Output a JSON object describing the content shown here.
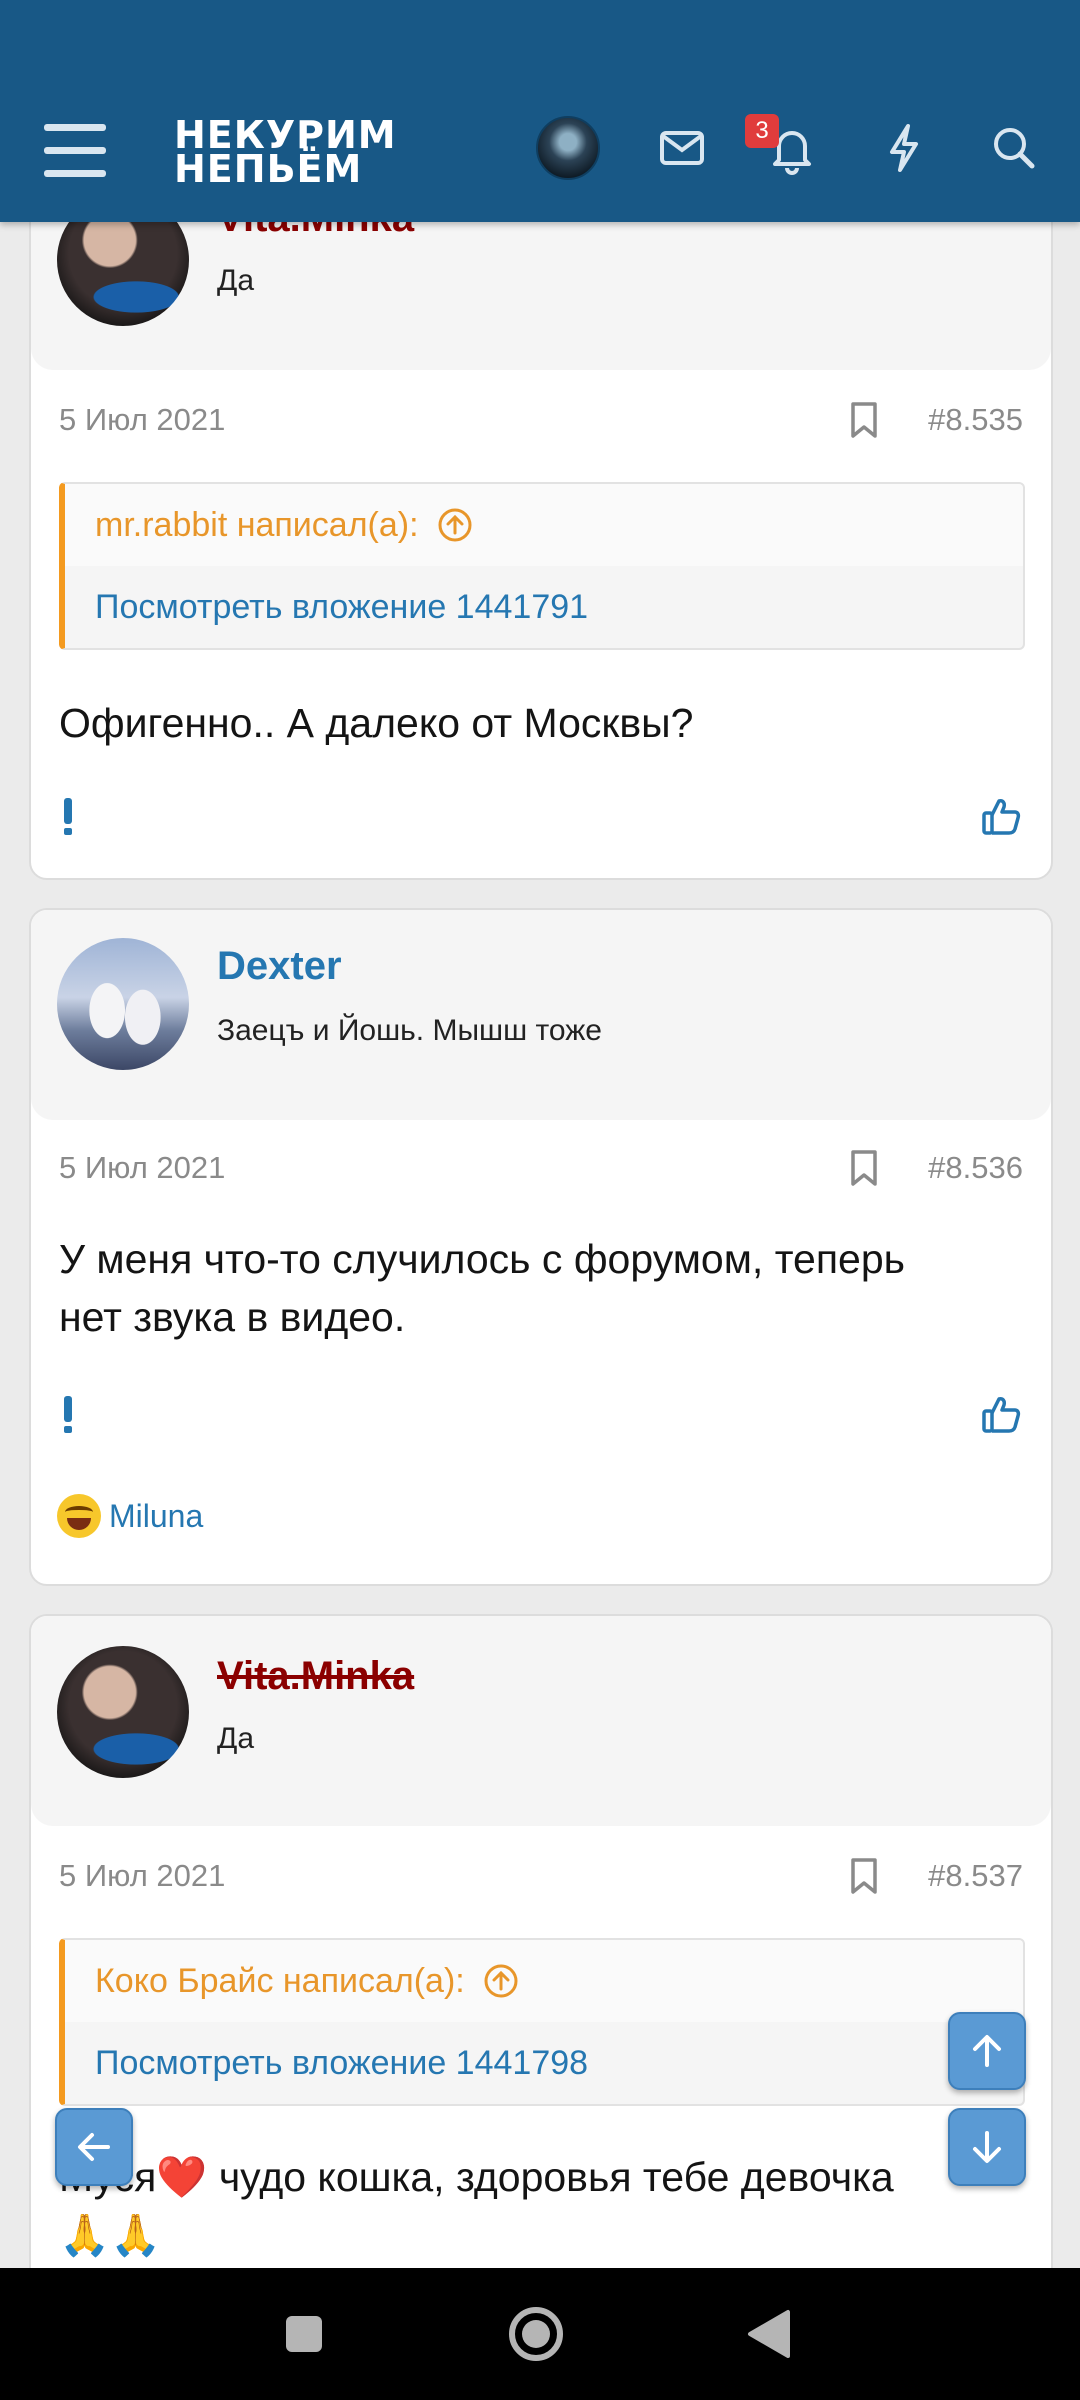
{
  "header": {
    "logo_line1": "НЕКУРИМ",
    "logo_line2": "НЕПЬЁМ",
    "notification_count": "3",
    "icons": [
      "menu-icon",
      "avatar",
      "mail-icon",
      "bell-icon",
      "lightning-icon",
      "search-icon"
    ]
  },
  "posts": [
    {
      "username": "Vita.Minka",
      "user_title": "Да",
      "date": "5 Июл 2021",
      "number": "#8.535",
      "quote_author": "mr.rabbit написал(а):",
      "quote_link": "Посмотреть вложение 1441791",
      "message": "Офигенно.. А далеко от Москвы?"
    },
    {
      "username": "Dexter",
      "user_title": "Заецъ и Йошь. Мышш тоже",
      "date": "5 Июл 2021",
      "number": "#8.536",
      "message_line1": "У меня что-то случилось с форумом, теперь",
      "message_line2": "нет звука в видео.",
      "reaction_user": "Miluna"
    },
    {
      "username": "Vita.Minka",
      "user_title": "Да",
      "date": "5 Июл 2021",
      "number": "#8.537",
      "quote_author": "Коко Брайс написал(а):",
      "quote_link": "Посмотреть вложение 1441798",
      "message_start": "Муся",
      "message_heart": "❤️",
      "message_rest": " чудо кошка, здоровья тебе девочка",
      "message_line2": "🙏🙏"
    }
  ],
  "colors": {
    "header_bg": "#185886",
    "link_blue": "#2577b1",
    "quote_orange": "#f49a1f",
    "banned_red": "#8b0000",
    "badge_red": "#e03c3c",
    "fab_blue": "#5a9ad4"
  }
}
